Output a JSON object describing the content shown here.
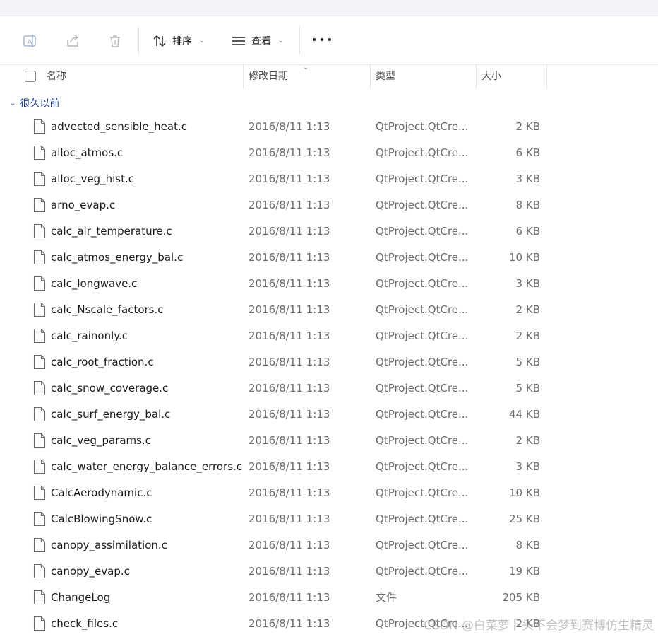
{
  "toolbar": {
    "sort_label": "排序",
    "view_label": "查看"
  },
  "columns": {
    "name": "名称",
    "modified": "修改日期",
    "type": "类型",
    "size": "大小"
  },
  "group": {
    "label": "很久以前"
  },
  "files": [
    {
      "name": "advected_sensible_heat.c",
      "date": "2016/8/11 1:13",
      "type": "QtProject.QtCre...",
      "size": "2 KB"
    },
    {
      "name": "alloc_atmos.c",
      "date": "2016/8/11 1:13",
      "type": "QtProject.QtCre...",
      "size": "6 KB"
    },
    {
      "name": "alloc_veg_hist.c",
      "date": "2016/8/11 1:13",
      "type": "QtProject.QtCre...",
      "size": "3 KB"
    },
    {
      "name": "arno_evap.c",
      "date": "2016/8/11 1:13",
      "type": "QtProject.QtCre...",
      "size": "8 KB"
    },
    {
      "name": "calc_air_temperature.c",
      "date": "2016/8/11 1:13",
      "type": "QtProject.QtCre...",
      "size": "6 KB"
    },
    {
      "name": "calc_atmos_energy_bal.c",
      "date": "2016/8/11 1:13",
      "type": "QtProject.QtCre...",
      "size": "10 KB"
    },
    {
      "name": "calc_longwave.c",
      "date": "2016/8/11 1:13",
      "type": "QtProject.QtCre...",
      "size": "3 KB"
    },
    {
      "name": "calc_Nscale_factors.c",
      "date": "2016/8/11 1:13",
      "type": "QtProject.QtCre...",
      "size": "2 KB"
    },
    {
      "name": "calc_rainonly.c",
      "date": "2016/8/11 1:13",
      "type": "QtProject.QtCre...",
      "size": "2 KB"
    },
    {
      "name": "calc_root_fraction.c",
      "date": "2016/8/11 1:13",
      "type": "QtProject.QtCre...",
      "size": "5 KB"
    },
    {
      "name": "calc_snow_coverage.c",
      "date": "2016/8/11 1:13",
      "type": "QtProject.QtCre...",
      "size": "5 KB"
    },
    {
      "name": "calc_surf_energy_bal.c",
      "date": "2016/8/11 1:13",
      "type": "QtProject.QtCre...",
      "size": "44 KB"
    },
    {
      "name": "calc_veg_params.c",
      "date": "2016/8/11 1:13",
      "type": "QtProject.QtCre...",
      "size": "2 KB"
    },
    {
      "name": "calc_water_energy_balance_errors.c",
      "date": "2016/8/11 1:13",
      "type": "QtProject.QtCre...",
      "size": "3 KB"
    },
    {
      "name": "CalcAerodynamic.c",
      "date": "2016/8/11 1:13",
      "type": "QtProject.QtCre...",
      "size": "10 KB"
    },
    {
      "name": "CalcBlowingSnow.c",
      "date": "2016/8/11 1:13",
      "type": "QtProject.QtCre...",
      "size": "25 KB"
    },
    {
      "name": "canopy_assimilation.c",
      "date": "2016/8/11 1:13",
      "type": "QtProject.QtCre...",
      "size": "8 KB"
    },
    {
      "name": "canopy_evap.c",
      "date": "2016/8/11 1:13",
      "type": "QtProject.QtCre...",
      "size": "19 KB"
    },
    {
      "name": "ChangeLog",
      "date": "2016/8/11 1:13",
      "type": "文件",
      "size": "205 KB"
    },
    {
      "name": "check_files.c",
      "date": "2016/8/11 1:13",
      "type": "QtProject.QtCre...",
      "size": "2 KB"
    }
  ],
  "watermark": "CSDN @白菜萝卜头不会梦到赛博仿生精灵"
}
